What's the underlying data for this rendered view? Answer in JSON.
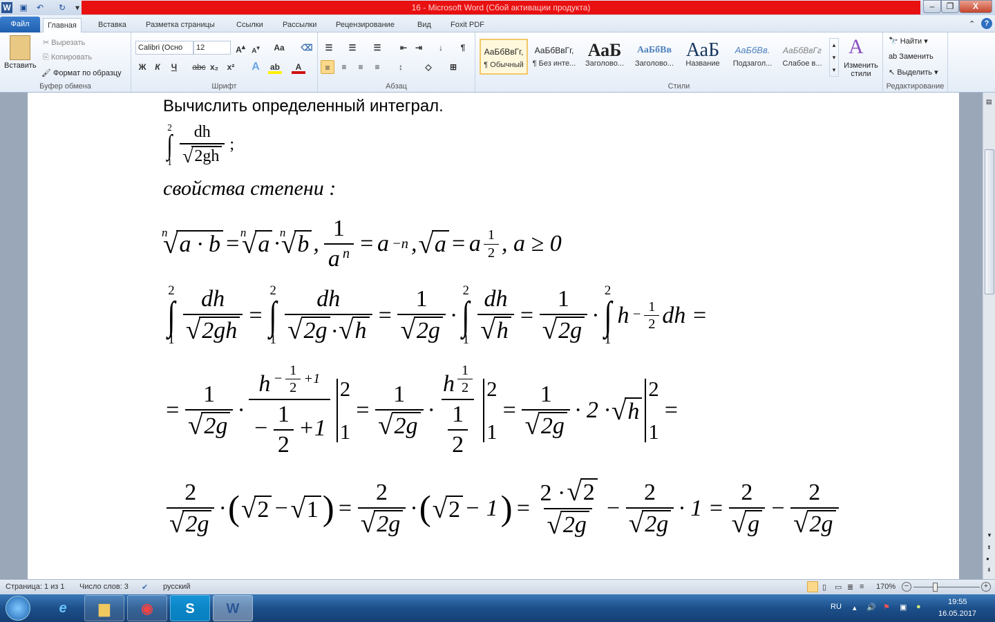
{
  "window": {
    "title": "16  -  Microsoft Word (Сбой активации продукта)",
    "minimize": "–",
    "restore": "❐",
    "close": "X"
  },
  "tabs": [
    "Файл",
    "Главная",
    "Вставка",
    "Разметка страницы",
    "Ссылки",
    "Рассылки",
    "Рецензирование",
    "Вид",
    "Foxit PDF"
  ],
  "clipboard": {
    "paste": "Вставить",
    "cut": "Вырезать",
    "copy": "Копировать",
    "format_painter": "Формат по образцу",
    "label": "Буфер обмена"
  },
  "font": {
    "name": "Calibri (Осно",
    "size": "12",
    "bold": "Ж",
    "italic": "К",
    "underline": "Ч",
    "strike": "abc",
    "sub": "x₂",
    "sup": "x²",
    "label": "Шрифт",
    "case": "Aa"
  },
  "paragraph": {
    "label": "Абзац",
    "pilcrow": "¶"
  },
  "styles": {
    "label": "Стили",
    "items": [
      {
        "preview": "АаБбВвГг,",
        "name": "¶ Обычный"
      },
      {
        "preview": "АаБбВвГг,",
        "name": "¶ Без инте..."
      },
      {
        "preview": "АаБ",
        "name": "Заголово..."
      },
      {
        "preview": "АаБбВв",
        "name": "Заголово..."
      },
      {
        "preview": "АаБ",
        "name": "Название"
      },
      {
        "preview": "АаБбВв.",
        "name": "Подзагол..."
      },
      {
        "preview": "АаБбВвГг",
        "name": "Слабое в..."
      }
    ],
    "change": "Изменить стили"
  },
  "editing": {
    "label": "Редактирование",
    "find": "Найти",
    "replace": "Заменить",
    "select": "Выделить"
  },
  "document": {
    "heading": "Вычислить определенный интеграл.",
    "task": [
      {
        "int": 1,
        "lo": "1",
        "hi": "2"
      },
      {
        "frac": [
          [
            {
              "t": "dh",
              "r": 1
            }
          ],
          [
            {
              "sqrt": [
                {
                  "t": "2gh",
                  "r": 1
                }
              ]
            }
          ]
        ]
      },
      {
        "t": ";",
        "r": 1
      }
    ],
    "props_title": "свойства  степени :",
    "lines": [
      [
        {
          "sqrt": [
            {
              "t": "a · b"
            }
          ],
          "n": "n"
        },
        {
          "t": "="
        },
        {
          "sqrt": [
            {
              "t": "a"
            }
          ],
          "n": "n"
        },
        {
          "t": "·"
        },
        {
          "sqrt": [
            {
              "t": "b"
            }
          ],
          "n": "n"
        },
        {
          "t": ",      "
        },
        {
          "frac": [
            [
              {
                "t": "1",
                "r": 1
              }
            ],
            [
              {
                "t": "a"
              },
              {
                "sup": [
                  {
                    "t": "n"
                  }
                ]
              }
            ]
          ]
        },
        {
          "t": "="
        },
        {
          "t": "a"
        },
        {
          "sup": [
            {
              "t": "−n"
            }
          ]
        },
        {
          "t": ",      "
        },
        {
          "sqrt": [
            {
              "t": "a"
            }
          ]
        },
        {
          "t": "="
        },
        {
          "t": "a"
        },
        {
          "sup": [
            {
              "frac": [
                [
                  {
                    "t": "1",
                    "r": 1
                  }
                ],
                [
                  {
                    "t": "2",
                    "r": 1
                  }
                ]
              ]
            }
          ]
        },
        {
          "t": ", a ≥ 0"
        }
      ],
      [
        {
          "int": 1,
          "lo": "1",
          "hi": "2"
        },
        {
          "frac": [
            [
              {
                "t": "dh"
              }
            ],
            [
              {
                "sqrt": [
                  {
                    "t": "2gh"
                  }
                ]
              }
            ]
          ]
        },
        {
          "t": "="
        },
        {
          "int": 1,
          "lo": "1",
          "hi": "2"
        },
        {
          "frac": [
            [
              {
                "t": "dh"
              }
            ],
            [
              {
                "sqrt": [
                  {
                    "t": "2g"
                  }
                ]
              },
              {
                "t": "·"
              },
              {
                "sqrt": [
                  {
                    "t": "h"
                  }
                ]
              }
            ]
          ]
        },
        {
          "t": "="
        },
        {
          "frac": [
            [
              {
                "t": "1",
                "r": 1
              }
            ],
            [
              {
                "sqrt": [
                  {
                    "t": "2g"
                  }
                ]
              }
            ]
          ]
        },
        {
          "t": "·"
        },
        {
          "int": 1,
          "lo": "1",
          "hi": "2"
        },
        {
          "frac": [
            [
              {
                "t": "dh"
              }
            ],
            [
              {
                "sqrt": [
                  {
                    "t": "h"
                  }
                ]
              }
            ]
          ]
        },
        {
          "t": "="
        },
        {
          "frac": [
            [
              {
                "t": "1",
                "r": 1
              }
            ],
            [
              {
                "sqrt": [
                  {
                    "t": "2g"
                  }
                ]
              }
            ]
          ]
        },
        {
          "t": "·"
        },
        {
          "int": 1,
          "lo": "1",
          "hi": "2"
        },
        {
          "t": "h"
        },
        {
          "sup": [
            {
              "t": "−"
            },
            {
              "frac": [
                [
                  {
                    "t": "1",
                    "r": 1
                  }
                ],
                [
                  {
                    "t": "2",
                    "r": 1
                  }
                ]
              ]
            }
          ]
        },
        {
          "t": "dh ="
        }
      ],
      [
        {
          "t": "="
        },
        {
          "frac": [
            [
              {
                "t": "1",
                "r": 1
              }
            ],
            [
              {
                "sqrt": [
                  {
                    "t": "2g"
                  }
                ]
              }
            ]
          ]
        },
        {
          "t": "·"
        },
        {
          "frac": [
            [
              {
                "t": "h"
              },
              {
                "sup": [
                  {
                    "t": "−"
                  },
                  {
                    "frac": [
                      [
                        {
                          "t": "1",
                          "r": 1
                        }
                      ],
                      [
                        {
                          "t": "2",
                          "r": 1
                        }
                      ]
                    ]
                  },
                  {
                    "t": "+1"
                  }
                ]
              }
            ],
            [
              {
                "t": "−"
              },
              {
                "frac": [
                  [
                    {
                      "t": "1",
                      "r": 1
                    }
                  ],
                  [
                    {
                      "t": "2",
                      "r": 1
                    }
                  ]
                ]
              },
              {
                "t": "+1"
              }
            ]
          ]
        },
        {
          "bar": 1,
          "lo": "1",
          "hi": "2"
        },
        {
          "t": "="
        },
        {
          "frac": [
            [
              {
                "t": "1",
                "r": 1
              }
            ],
            [
              {
                "sqrt": [
                  {
                    "t": "2g"
                  }
                ]
              }
            ]
          ]
        },
        {
          "t": "·"
        },
        {
          "frac": [
            [
              {
                "t": "h"
              },
              {
                "sup": [
                  {
                    "frac": [
                      [
                        {
                          "t": "1",
                          "r": 1
                        }
                      ],
                      [
                        {
                          "t": "2",
                          "r": 1
                        }
                      ]
                    ]
                  }
                ]
              }
            ],
            [
              {
                "frac": [
                  [
                    {
                      "t": "1",
                      "r": 1
                    }
                  ],
                  [
                    {
                      "t": "2",
                      "r": 1
                    }
                  ]
                ]
              }
            ]
          ]
        },
        {
          "bar": 1,
          "lo": "1",
          "hi": "2"
        },
        {
          "t": "="
        },
        {
          "frac": [
            [
              {
                "t": "1",
                "r": 1
              }
            ],
            [
              {
                "sqrt": [
                  {
                    "t": "2g"
                  }
                ]
              }
            ]
          ]
        },
        {
          "t": "· 2 ·"
        },
        {
          "sqrt": [
            {
              "t": "h"
            }
          ]
        },
        {
          "bar": 1,
          "lo": "1",
          "hi": "2"
        },
        {
          "t": "="
        }
      ],
      [
        {
          "frac": [
            [
              {
                "t": "2",
                "r": 1
              }
            ],
            [
              {
                "sqrt": [
                  {
                    "t": "2g"
                  }
                ]
              }
            ]
          ]
        },
        {
          "t": "·"
        },
        {
          "t": "(",
          "big": 1
        },
        {
          "sqrt": [
            {
              "t": "2",
              "r": 1
            }
          ]
        },
        {
          "t": "−"
        },
        {
          "sqrt": [
            {
              "t": "1",
              "r": 1
            }
          ]
        },
        {
          "t": ")",
          "big": 1
        },
        {
          "t": "="
        },
        {
          "frac": [
            [
              {
                "t": "2",
                "r": 1
              }
            ],
            [
              {
                "sqrt": [
                  {
                    "t": "2g"
                  }
                ]
              }
            ]
          ]
        },
        {
          "t": "·"
        },
        {
          "t": "(",
          "big": 1
        },
        {
          "sqrt": [
            {
              "t": "2",
              "r": 1
            }
          ]
        },
        {
          "t": "− 1"
        },
        {
          "t": ")",
          "big": 1
        },
        {
          "t": "="
        },
        {
          "frac": [
            [
              {
                "t": "2 ·",
                "r": 1
              },
              {
                "sqrt": [
                  {
                    "t": "2",
                    "r": 1
                  }
                ]
              }
            ],
            [
              {
                "sqrt": [
                  {
                    "t": "2g"
                  }
                ]
              }
            ]
          ]
        },
        {
          "t": "−"
        },
        {
          "frac": [
            [
              {
                "t": "2",
                "r": 1
              }
            ],
            [
              {
                "sqrt": [
                  {
                    "t": "2g"
                  }
                ]
              }
            ]
          ]
        },
        {
          "t": "· 1 ="
        },
        {
          "frac": [
            [
              {
                "t": "2",
                "r": 1
              }
            ],
            [
              {
                "sqrt": [
                  {
                    "t": "g"
                  }
                ]
              }
            ]
          ]
        },
        {
          "t": "−"
        },
        {
          "frac": [
            [
              {
                "t": "2",
                "r": 1
              }
            ],
            [
              {
                "sqrt": [
                  {
                    "t": "2g"
                  }
                ]
              }
            ]
          ]
        }
      ]
    ]
  },
  "status": {
    "page": "Страница: 1 из 1",
    "words": "Число слов: 3",
    "language": "русский",
    "zoom": "170%",
    "zoom_percent": 170
  },
  "taskbar": {
    "lang": "RU",
    "time": "19:55",
    "date": "16.05.2017"
  }
}
